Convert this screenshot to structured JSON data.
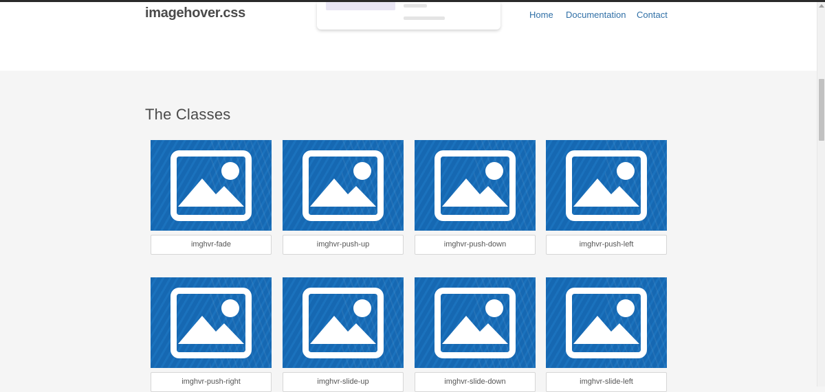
{
  "header": {
    "brand": "imagehover.css",
    "nav": [
      {
        "label": "Home"
      },
      {
        "label": "Documentation"
      },
      {
        "label": "Contact"
      }
    ]
  },
  "main": {
    "section_title": "The Classes",
    "cards": [
      {
        "label": "imghvr-fade"
      },
      {
        "label": "imghvr-push-up"
      },
      {
        "label": "imghvr-push-down"
      },
      {
        "label": "imghvr-push-left"
      },
      {
        "label": "imghvr-push-right"
      },
      {
        "label": "imghvr-slide-up"
      },
      {
        "label": "imghvr-slide-down"
      },
      {
        "label": "imghvr-slide-left"
      }
    ]
  },
  "colors": {
    "thumb_blue": "#1668b2",
    "nav_link": "#2f6fa6",
    "page_bg": "#f5f5f5"
  },
  "icons": {
    "thumbnail": "image-placeholder-icon"
  }
}
